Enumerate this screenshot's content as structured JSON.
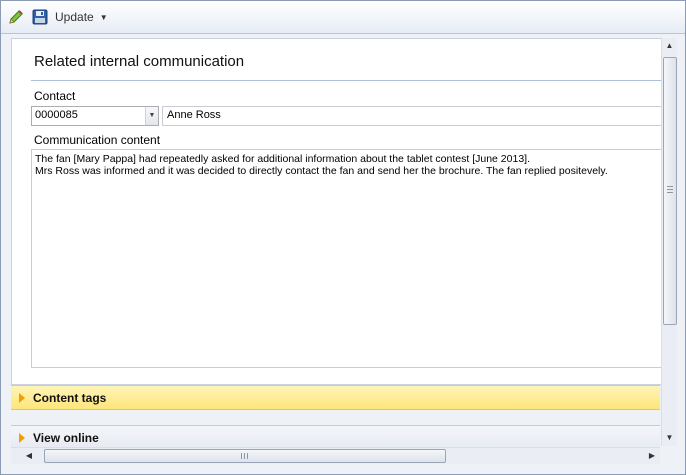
{
  "toolbar": {
    "edit_icon": "pencil-edit-icon",
    "save_icon": "floppy-save-icon",
    "update_label": "Update"
  },
  "form": {
    "title": "Related internal communication",
    "contact_label": "Contact",
    "contact_id": "0000085",
    "contact_name": "Anne Ross",
    "communication_label": "Communication content",
    "communication_text": "The fan [Mary Pappa] had repeatedly asked for additional information about the tablet contest [June 2013].\nMrs Ross was informed and it was decided to directly contact the fan and send her the brochure. The fan replied positevely."
  },
  "sections": [
    {
      "label": "Content tags",
      "highlighted": true
    },
    {
      "label": "View online",
      "highlighted": false
    }
  ],
  "colors": {
    "accent_yellow": "#fde67a",
    "arrow_orange": "#f0a000",
    "rule_blue": "#aebfd6"
  }
}
